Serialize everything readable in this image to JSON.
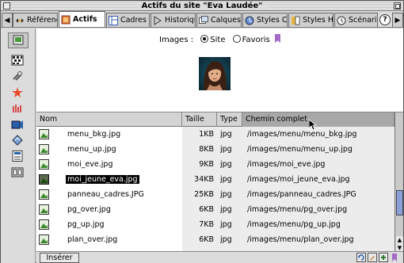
{
  "window": {
    "title": "Actifs du site \"Eva Laudée\""
  },
  "tabs": [
    {
      "label": "Références",
      "icon": "references-icon",
      "active": false
    },
    {
      "label": "Actifs",
      "icon": "assets-icon",
      "active": true
    },
    {
      "label": "Cadres",
      "icon": "frames-icon",
      "active": false
    },
    {
      "label": "Historique",
      "icon": "history-icon",
      "active": false
    },
    {
      "label": "Calques",
      "icon": "layers-icon",
      "active": false
    },
    {
      "label": "Styles CSS",
      "icon": "css-styles-icon",
      "active": false
    },
    {
      "label": "Styles HTML",
      "icon": "html-styles-icon",
      "active": false
    },
    {
      "label": "Scénario",
      "icon": "timeline-icon",
      "active": false
    }
  ],
  "side_icons": [
    "images-icon",
    "colors-icon",
    "urls-icon",
    "flash-icon",
    "shockwave-icon",
    "movies-icon",
    "scripts-icon",
    "templates-icon",
    "library-icon"
  ],
  "images_selector": {
    "label": "Images :",
    "option_site": "Site",
    "option_favorites": "Favoris",
    "selected": "Site"
  },
  "table": {
    "columns": {
      "name": "Nom",
      "size": "Taille",
      "type": "Type",
      "path": "Chemin complet"
    },
    "rows": [
      {
        "name": "menu_bkg.jpg",
        "size": "1KB",
        "type": "jpg",
        "path": "/images/menu/menu_bkg.jpg",
        "selected": false
      },
      {
        "name": "menu_up.jpg",
        "size": "8KB",
        "type": "jpg",
        "path": "/images/menu/menu_up.jpg",
        "selected": false
      },
      {
        "name": "moi_eve.jpg",
        "size": "9KB",
        "type": "jpg",
        "path": "/images/moi_eve.jpg",
        "selected": false
      },
      {
        "name": "moi_jeune_eva.jpg",
        "size": "34KB",
        "type": "jpg",
        "path": "/images/moi_jeune_eva.jpg",
        "selected": true
      },
      {
        "name": "panneau_cadres.JPG",
        "size": "25KB",
        "type": "jpg",
        "path": "/images/panneau_cadres.JPG",
        "selected": false
      },
      {
        "name": "pg_over.jpg",
        "size": "6KB",
        "type": "jpg",
        "path": "/images/menu/pg_over.jpg",
        "selected": false
      },
      {
        "name": "pg_up.jpg",
        "size": "7KB",
        "type": "jpg",
        "path": "/images/menu/pg_up.jpg",
        "selected": false
      },
      {
        "name": "plan_over.jpg",
        "size": "6KB",
        "type": "jpg",
        "path": "/images/menu/plan_over.jpg",
        "selected": false
      }
    ]
  },
  "bottom": {
    "insert_label": "Insérer"
  },
  "colors": {
    "accent": "#8aa0d6",
    "favorites": "#a46ac8",
    "selection": "#000000"
  }
}
